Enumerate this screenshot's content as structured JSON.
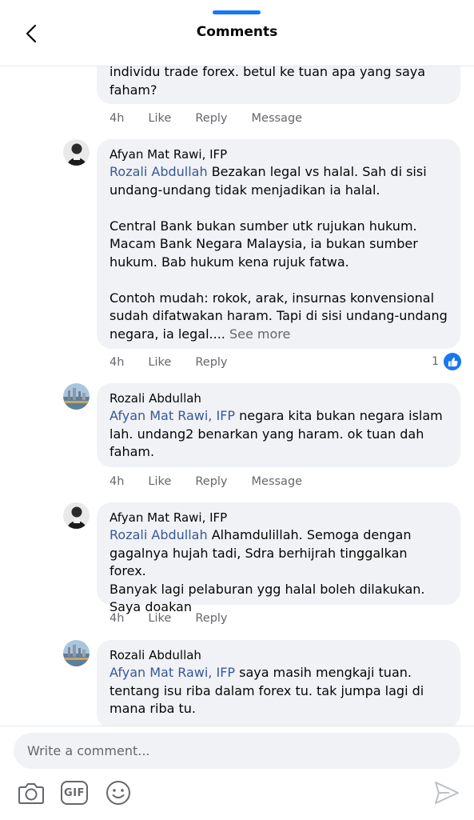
{
  "header": {
    "title": "Comments"
  },
  "comments": [
    {
      "text_prefix": "",
      "text": "individu trade forex. betul ke tuan apa yang saya\nfaham?",
      "time": "4h",
      "like": "Like",
      "reply": "Reply",
      "message": "Message"
    },
    {
      "author": "Afyan Mat Rawi, IFP",
      "tag": "Rozali Abdullah",
      "text": " Bezakan legal vs halal. Sah di sisi\nundang-undang tidak menjadikan ia halal.\n\nCentral Bank bukan sumber utk rujukan hukum.\nMacam Bank Negara Malaysia, ia bukan sumber\nhukum. Bab hukum kena rujuk fatwa.\n\nContoh mudah: rokok, arak, insurnas konvensional\nsudah difatwakan haram. Tapi di sisi undang-undang\nnegara, ia legal....",
      "see_more": " See more",
      "time": "4h",
      "like": "Like",
      "reply": "Reply",
      "reaction_count": "1"
    },
    {
      "author": "Rozali Abdullah",
      "tag": "Afyan Mat Rawi, IFP",
      "text": " negara kita bukan negara islam\nlah. undang2 benarkan yang haram. ok tuan dah\nfaham.",
      "time": "4h",
      "like": "Like",
      "reply": "Reply",
      "message": "Message"
    },
    {
      "author": "Afyan Mat Rawi, IFP",
      "tag": "Rozali Abdullah",
      "text": " Alhamdulillah. Semoga dengan\ngagalnya hujah tadi, Sdra berhijrah tinggalkan forex.\nBanyak lagi pelaburan ygg halal boleh dilakukan.\nSaya doakan",
      "time": "4h",
      "like": "Like",
      "reply": "Reply"
    },
    {
      "author": "Rozali Abdullah",
      "tag": "Afyan Mat Rawi, IFP",
      "text": " saya masih mengkaji tuan.\ntentang isu riba dalam forex tu. tak jumpa lagi di\nmana riba tu."
    }
  ],
  "composer": {
    "placeholder": "Write a comment...",
    "gif_label": "GIF"
  },
  "colors": {
    "accent": "#1877f2",
    "tag": "#385898",
    "bubble": "#f0f2f5",
    "muted": "#65676b"
  },
  "icons": [
    "back-arrow-icon",
    "camera-icon",
    "gif-icon",
    "emoji-icon",
    "send-icon",
    "like-icon"
  ]
}
